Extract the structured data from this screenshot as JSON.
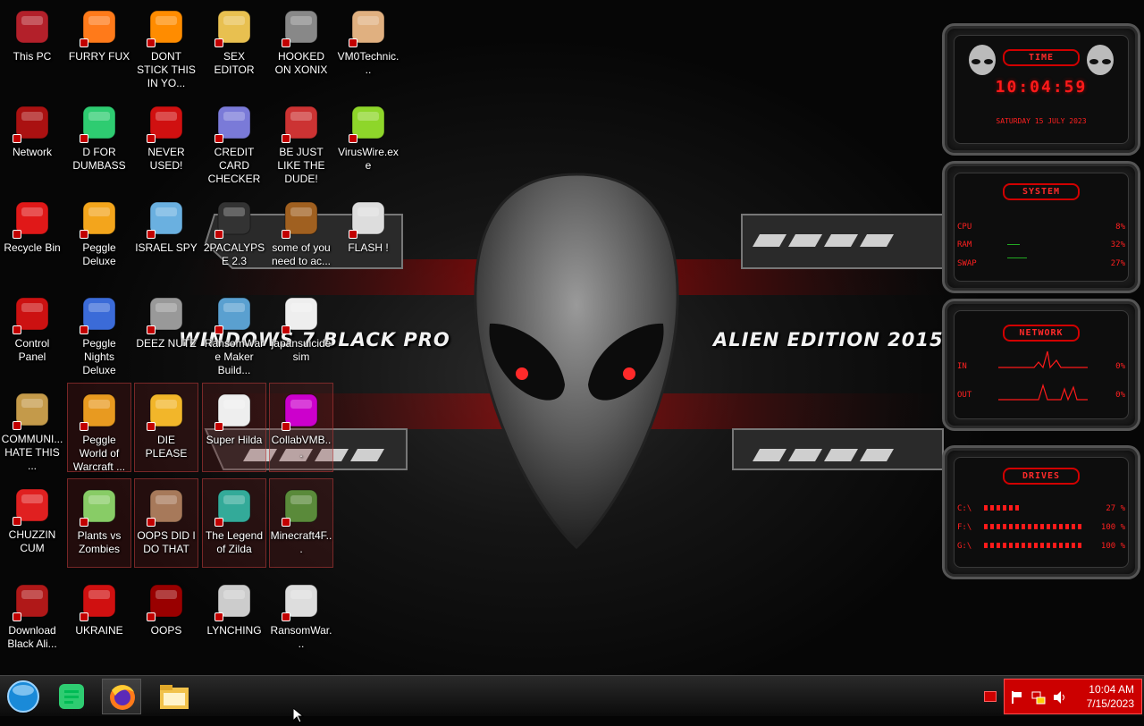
{
  "desktop": {
    "wallpaper": {
      "left_text": "WINDOWS 7 BLACK PRO",
      "right_text": "ALIEN EDITION 2015"
    },
    "icons": [
      {
        "label": "This PC",
        "icon": "monitor-icon",
        "selected": false
      },
      {
        "label": "FURRY FUX",
        "icon": "firefox-icon",
        "selected": false
      },
      {
        "label": "DONT STICK THIS IN YO...",
        "icon": "vlc-cone-icon",
        "selected": false
      },
      {
        "label": "SEX EDITOR",
        "icon": "hxd-editor-icon",
        "selected": false
      },
      {
        "label": "HOOKED ON XONIX",
        "icon": "xonix-game-icon",
        "selected": false
      },
      {
        "label": "VM0Technic...",
        "icon": "doctor-icon",
        "selected": false
      },
      {
        "label": "Network",
        "icon": "network-icon",
        "selected": false
      },
      {
        "label": "D FOR DUMBASS",
        "icon": "green-chat-icon",
        "selected": false
      },
      {
        "label": "NEVER USED!",
        "icon": "devcpp-icon",
        "selected": false
      },
      {
        "label": "CREDIT CARD CHECKER",
        "icon": "credit-card-icon",
        "selected": false
      },
      {
        "label": "BE JUST LIKE THE DUDE!",
        "icon": "santa-icon",
        "selected": false
      },
      {
        "label": "VirusWire.exe",
        "icon": "lime-icon",
        "selected": false
      },
      {
        "label": "Recycle Bin",
        "icon": "recycle-bin-icon",
        "selected": false
      },
      {
        "label": "Peggle Deluxe",
        "icon": "peggle-icon",
        "selected": false
      },
      {
        "label": "ISRAEL SPY",
        "icon": "spy-network-icon",
        "selected": false
      },
      {
        "label": "2PACALYPSE 2.3",
        "icon": "terminal-icon",
        "selected": false
      },
      {
        "label": "some of you need to ac...",
        "icon": "beaver-icon",
        "selected": false
      },
      {
        "label": "FLASH !",
        "icon": "flash-icon",
        "selected": false
      },
      {
        "label": "Control Panel",
        "icon": "control-panel-icon",
        "selected": false
      },
      {
        "label": "Peggle Nights Deluxe",
        "icon": "peggle-nights-icon",
        "selected": false
      },
      {
        "label": "DEEZ NUTZ",
        "icon": "stacked-windows-icon",
        "selected": false
      },
      {
        "label": "RansomWare Maker Build...",
        "icon": "window-app-icon",
        "selected": false
      },
      {
        "label": "japansuicide sim",
        "icon": "document-icon",
        "selected": false
      },
      {
        "label": "",
        "icon": "",
        "selected": false
      },
      {
        "label": "COMMUNI... HATE THIS ...",
        "icon": "money-bag-icon",
        "selected": false
      },
      {
        "label": "Peggle World of Warcraft ...",
        "icon": "peggle-wow-icon",
        "selected": true
      },
      {
        "label": "DIE PLEASE",
        "icon": "de-icon",
        "selected": true
      },
      {
        "label": "Super Hilda",
        "icon": "pixel-cat-icon",
        "selected": true
      },
      {
        "label": "CollabVMB...",
        "icon": "collabvm-icon",
        "selected": true
      },
      {
        "label": "",
        "icon": "",
        "selected": false
      },
      {
        "label": "CHUZZIN CUM",
        "icon": "chuzzle-icon",
        "selected": false
      },
      {
        "label": "Plants vs Zombies",
        "icon": "flower-icon",
        "selected": true
      },
      {
        "label": "OOPS DID I DO THAT",
        "icon": "portrait-icon",
        "selected": true
      },
      {
        "label": "The Legend of Zilda",
        "icon": "pixel-hero-icon",
        "selected": true
      },
      {
        "label": "Minecraft4F...",
        "icon": "grass-block-icon",
        "selected": true
      },
      {
        "label": "",
        "icon": "",
        "selected": false
      },
      {
        "label": "Download Black Ali...",
        "icon": "alien-orb-icon",
        "selected": false
      },
      {
        "label": "UKRAINE",
        "icon": "radiation-icon",
        "selected": false
      },
      {
        "label": "OOPS",
        "icon": "red-square-icon",
        "selected": false
      },
      {
        "label": "LYNCHING",
        "icon": "gear-badge-icon",
        "selected": false
      },
      {
        "label": "RansomWar...",
        "icon": "skull-icon",
        "selected": false
      },
      {
        "label": "",
        "icon": "",
        "selected": false
      }
    ]
  },
  "gadgets": {
    "time": {
      "title": "TIME",
      "clock": "10:04:59",
      "date": "SATURDAY 15 JULY 2023"
    },
    "system": {
      "title": "SYSTEM",
      "rows": [
        {
          "label": "CPU",
          "value": "8%"
        },
        {
          "label": "RAM",
          "value": "32%"
        },
        {
          "label": "SWAP",
          "value": "27%"
        }
      ]
    },
    "network": {
      "title": "NETWORK",
      "rows": [
        {
          "label": "IN",
          "value": "0%"
        },
        {
          "label": "OUT",
          "value": "0%"
        }
      ]
    },
    "drives": {
      "title": "DRIVES",
      "rows": [
        {
          "label": "C:\\",
          "value": "27 %"
        },
        {
          "label": "F:\\",
          "value": "100 %"
        },
        {
          "label": "G:\\",
          "value": "100 %"
        }
      ]
    }
  },
  "taskbar": {
    "buttons": [
      {
        "icon": "start-orb-icon"
      },
      {
        "icon": "green-chat-icon"
      },
      {
        "icon": "firefox-icon",
        "active": true
      },
      {
        "icon": "file-explorer-icon"
      }
    ],
    "tray": {
      "time": "10:04 AM",
      "date": "7/15/2023"
    }
  },
  "colors": {
    "accent": "#ff1a1a",
    "tray": "#cc0000"
  }
}
